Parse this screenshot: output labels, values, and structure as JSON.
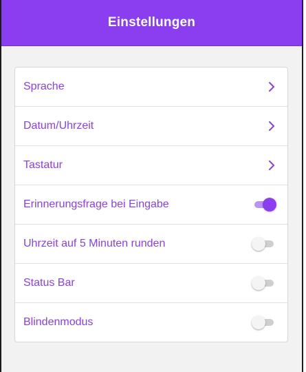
{
  "app": {
    "title": "Einstellungen",
    "accent_color": "#8a3ef0",
    "background_color": "#f2f2f2"
  },
  "settings": {
    "items": [
      {
        "label": "Sprache",
        "control": "chevron-right-icon"
      },
      {
        "label": "Datum/Uhrzeit",
        "control": "chevron-right-icon"
      },
      {
        "label": "Tastatur",
        "control": "chevron-right-icon"
      },
      {
        "label": "Erinnerungsfrage bei Eingabe",
        "control": "toggle",
        "enabled": true
      },
      {
        "label": "Uhrzeit auf 5 Minuten runden",
        "control": "toggle",
        "enabled": false
      },
      {
        "label": "Status Bar",
        "control": "toggle",
        "enabled": false
      },
      {
        "label": "Blindenmodus",
        "control": "toggle",
        "enabled": false
      }
    ]
  }
}
